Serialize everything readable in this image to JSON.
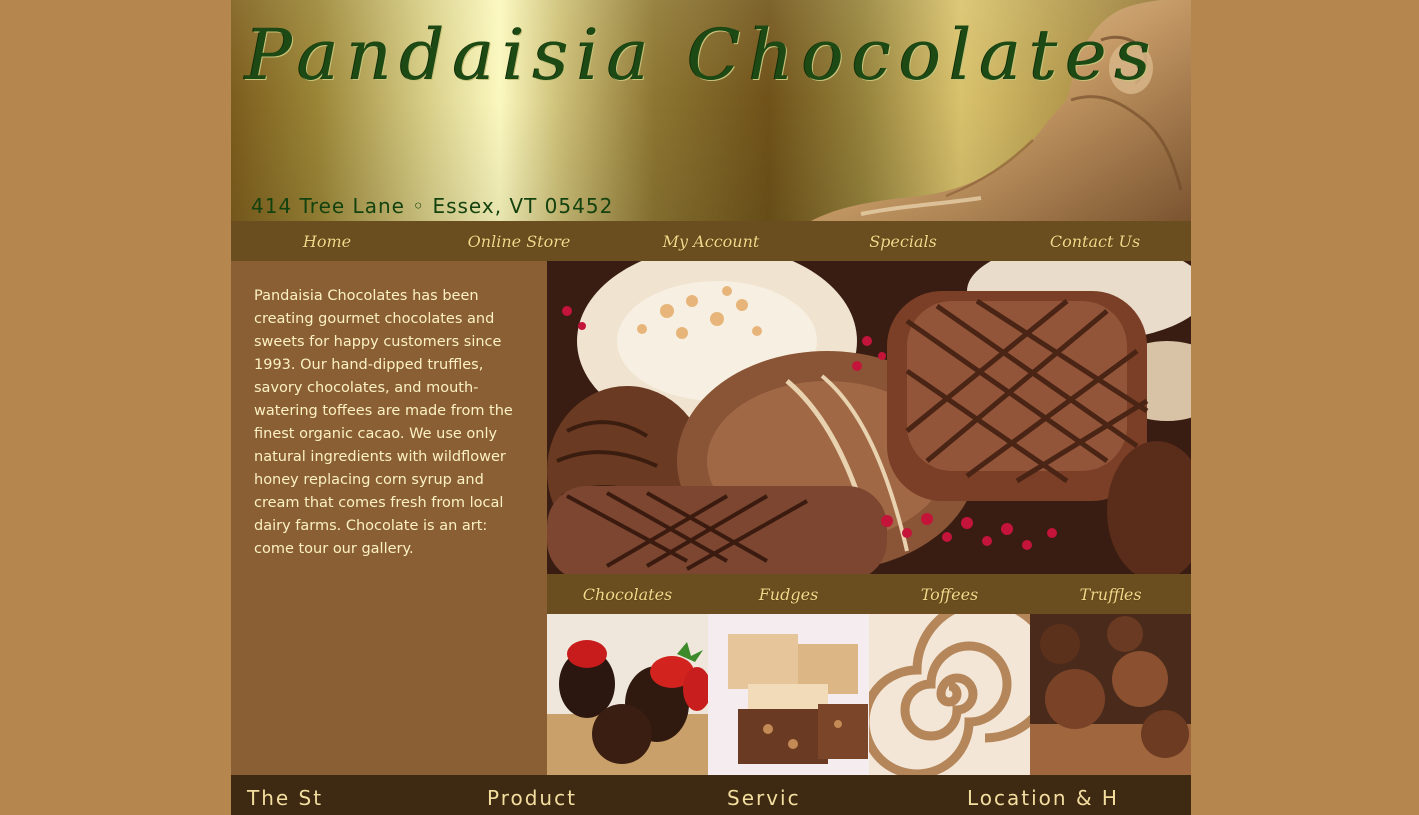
{
  "header": {
    "brand_name": "Pandaisia Chocolates",
    "address": "414 Tree Lane ◦ Essex, VT 05452"
  },
  "nav": {
    "items": [
      {
        "label": "Home"
      },
      {
        "label": "Online Store"
      },
      {
        "label": "My Account"
      },
      {
        "label": "Specials"
      },
      {
        "label": "Contact Us"
      }
    ]
  },
  "intro": {
    "text": "Pandaisia Chocolates has been creating gourmet chocolates and sweets for happy customers since 1993. Our hand-dipped truffles, savory chocolates, and mouth-watering toffees are made from the finest organic cacao. We use only natural ingredients with wildflower honey replacing corn syrup and cream that comes fresh from local dairy farms. Chocolate is an art: come tour our gallery."
  },
  "categories": {
    "items": [
      {
        "label": "Chocolates"
      },
      {
        "label": "Fudges"
      },
      {
        "label": "Toffees"
      },
      {
        "label": "Truffles"
      }
    ]
  },
  "footer": {
    "headings": [
      {
        "label": "The St"
      },
      {
        "label": "Product"
      },
      {
        "label": "Servic"
      },
      {
        "label": "Location & H"
      }
    ]
  },
  "colors": {
    "page_background": "#b5864e",
    "content_background": "#8a5f33",
    "nav_background": "#6b4e1f",
    "nav_text": "#f2d98a",
    "brand_green": "#1d4a14",
    "footer_background": "#3e2a12"
  },
  "icons": {
    "header_art": "reclining-statue-image",
    "hero": "assorted-chocolates-photo",
    "thumbs": [
      "chocolate-strawberries-photo",
      "fudge-squares-photo",
      "chocolate-swirl-photo",
      "cocoa-truffles-photo"
    ]
  }
}
